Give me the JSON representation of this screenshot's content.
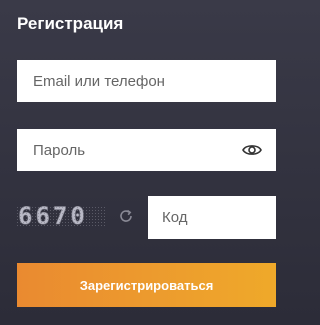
{
  "form": {
    "title": "Регистрация",
    "email_placeholder": "Email или телефон",
    "password_placeholder": "Пароль",
    "captcha_text": "6670",
    "code_placeholder": "Код",
    "submit_label": "Зарегистрироваться"
  },
  "icons": {
    "eye": "eye-icon",
    "refresh": "refresh-icon"
  },
  "colors": {
    "background": "#33333f",
    "button_start": "#ea8a30",
    "button_end": "#efa92a",
    "field_bg": "#ffffff"
  }
}
